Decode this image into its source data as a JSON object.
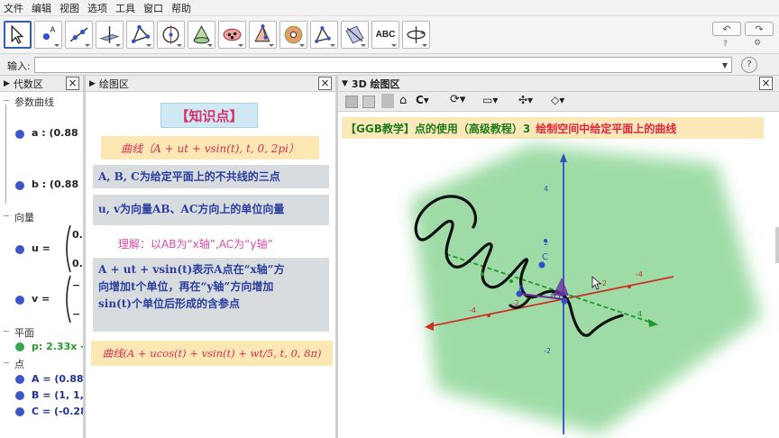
{
  "menu": [
    "文件",
    "编辑",
    "视图",
    "选项",
    "工具",
    "窗口",
    "帮助"
  ],
  "toolbar": {
    "tools": [
      "move-tool",
      "point-tool",
      "line-tool",
      "perpendicular-tool",
      "polygon-tool",
      "circle-tool",
      "intersect-tool",
      "conic-tool",
      "pyramid-tool",
      "sphere-tool",
      "reflect-tool",
      "plane-tool",
      "text-tool",
      "rotate-view-tool"
    ],
    "text_tool_label": "ABC",
    "undo": "↶",
    "redo": "↷",
    "help": "?",
    "settings": "⚙"
  },
  "input_bar": {
    "label": "输入:",
    "value": "",
    "help": "?"
  },
  "panels": {
    "algebra": "代数区",
    "graphics": "绘图区",
    "graphics3d": "3D 绘图区",
    "close": "×"
  },
  "algebra": {
    "groups": {
      "curves": "参数曲线",
      "vectors": "向量",
      "plane": "平面",
      "points": "点"
    },
    "curve_a": "a : (0.88",
    "curve_b": "b : (0.88",
    "vec_u": "u =",
    "vec_u_top": "0.",
    "vec_u_bot": "0.",
    "vec_v": "v =",
    "vec_v_top": "−",
    "vec_v_bot": "−",
    "plane_p": "p: 2.33x -",
    "point_a": "A = (0.88,",
    "point_b": "B = (1, 1,",
    "point_c": "C = (-0.28"
  },
  "graphics": {
    "knowledge": "【知识点】",
    "curve_expr": "曲线（A + ut + vsin(t), t, 0, 2pi）",
    "noncollinear": "A, B, C为给定平面上的不共线的三点",
    "unit_vectors": "u, v为向量AB、AC方向上的单位向量",
    "understanding": "理解：以AB为“x轴”,AC为“y轴”",
    "expl_line1": "A + ut + vsin(t)表示A点在“x轴”方",
    "expl_line2": "向增加t个单位，再在“y轴”方向增加",
    "expl_line3": "sin(t)个单位后形成的含参点",
    "curve2": "曲线(A + ucos(t) + vsin(t) + wt/5, t, 0, 8π)"
  },
  "graphics3d": {
    "title_green": "【GGB教学】点的使用（高级教程）3",
    "title_red": "绘制空间中给定平面上的曲线",
    "axis_labels": {
      "z_pos4": "4",
      "z_pos2": "2",
      "z_neg2": "-2",
      "x_neg4": "-4",
      "x_neg2": "-2",
      "y_pos4": "4",
      "y_neg4": "-4",
      "y_neg2": "-2",
      "origin": "0"
    },
    "point_labels": {
      "A": "A",
      "B": "B",
      "C": "C"
    }
  },
  "colors": {
    "plane": "#7fd08a",
    "curve": "#111111",
    "x_axis": "#d0302a",
    "y_axis": "#1d9a2e",
    "z_axis": "#3150c0",
    "point": "#2f4fd0",
    "active_tool": "#2f5fb8"
  }
}
